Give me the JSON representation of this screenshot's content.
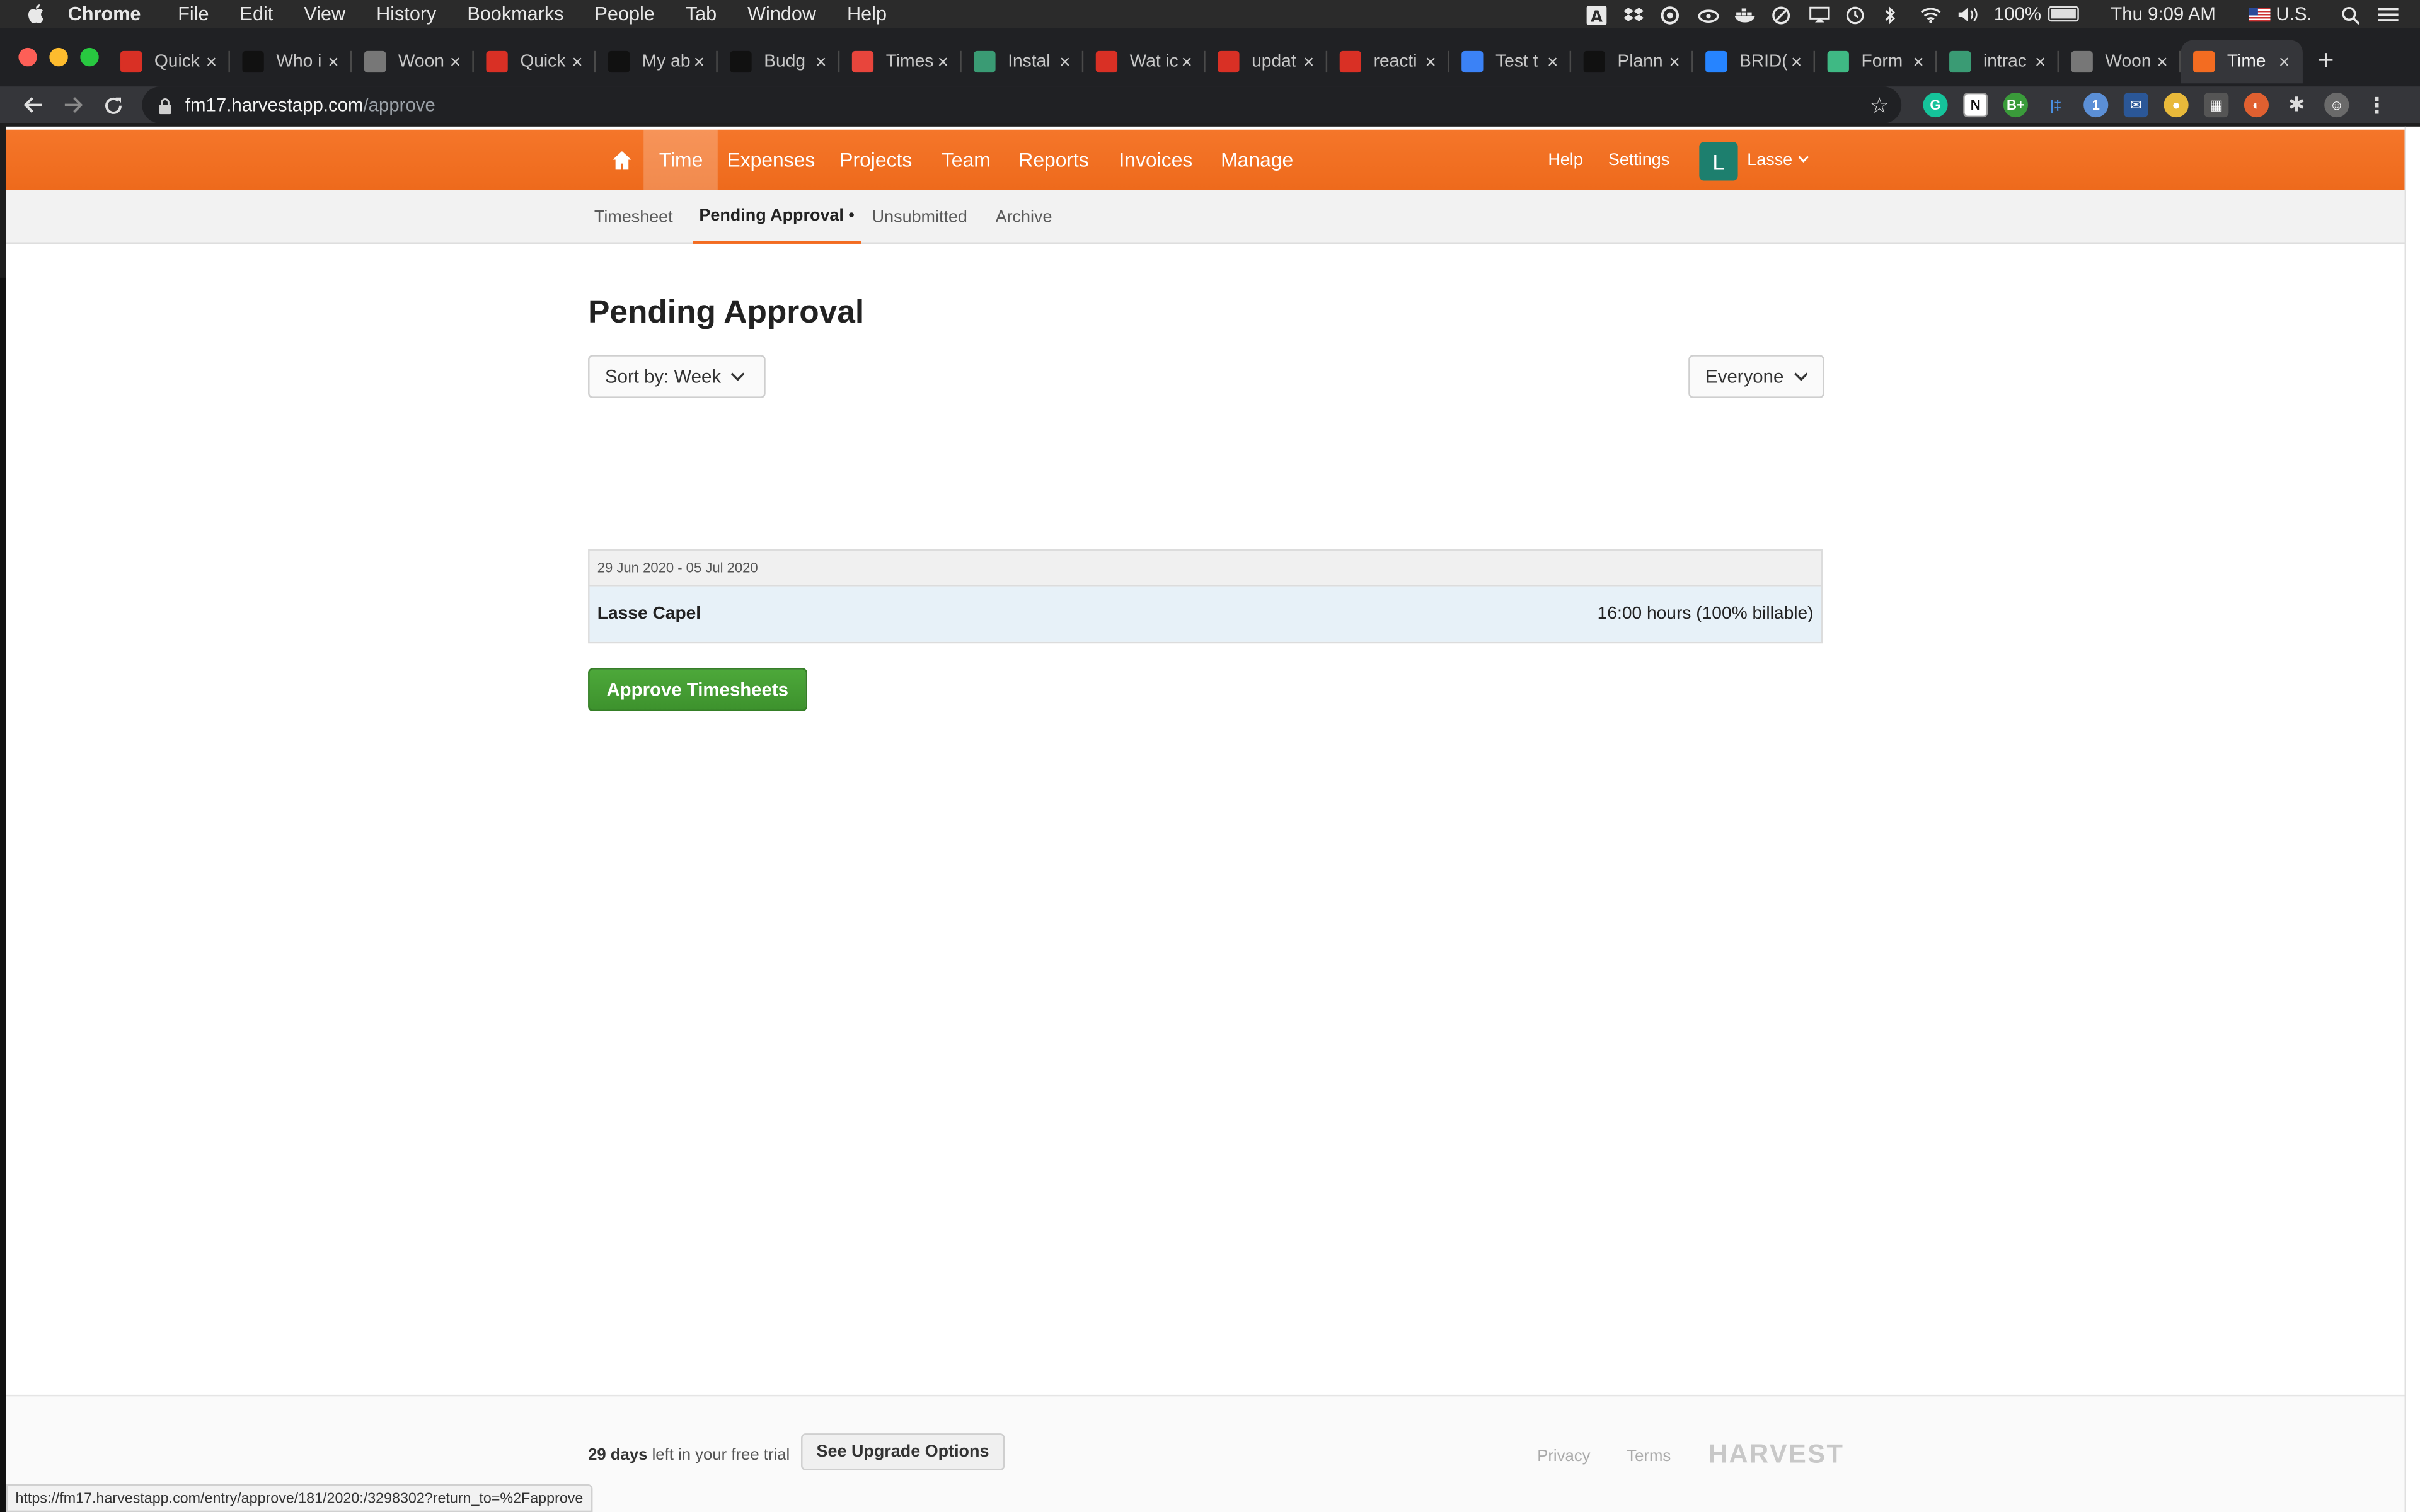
{
  "mac_menu": {
    "app_name": "Chrome",
    "items": [
      "File",
      "Edit",
      "View",
      "History",
      "Bookmarks",
      "People",
      "Tab",
      "Window",
      "Help"
    ],
    "battery": "100%",
    "clock": "Thu 9:09 AM",
    "input_source": "U.S."
  },
  "browser": {
    "tabs": [
      {
        "title": "Quick",
        "icon": "app-grid-icon",
        "color": "#d93025"
      },
      {
        "title": "Who i",
        "icon": "mustache-icon",
        "color": "#111111"
      },
      {
        "title": "Woon",
        "icon": "globe-icon",
        "color": "#777777"
      },
      {
        "title": "Quick",
        "icon": "app-grid-icon",
        "color": "#d93025"
      },
      {
        "title": "My ab",
        "icon": "mustache-icon",
        "color": "#111111"
      },
      {
        "title": "Budg",
        "icon": "mustache-icon",
        "color": "#111111"
      },
      {
        "title": "Times",
        "icon": "harvest-clock-icon",
        "color": "#e8453c"
      },
      {
        "title": "Instal",
        "icon": "triangle-icon",
        "color": "#3a9b74"
      },
      {
        "title": "Wat ic",
        "icon": "gmail-icon",
        "color": "#d93025"
      },
      {
        "title": "updat",
        "icon": "gmail-icon",
        "color": "#d93025"
      },
      {
        "title": "reacti",
        "icon": "gmail-icon",
        "color": "#d93025"
      },
      {
        "title": "Test t",
        "icon": "f-icon",
        "color": "#3b82f6"
      },
      {
        "title": "Plann",
        "icon": "mustache-icon",
        "color": "#111111"
      },
      {
        "title": "BRID(",
        "icon": "diamond-icon",
        "color": "#2684ff"
      },
      {
        "title": "Form",
        "icon": "v-icon",
        "color": "#3fb984"
      },
      {
        "title": "intrac",
        "icon": "triangle-icon",
        "color": "#3a9b74"
      },
      {
        "title": "Woon",
        "icon": "globe-icon",
        "color": "#777777"
      },
      {
        "title": "Time",
        "icon": "harvest-h-icon",
        "color": "#f36c21",
        "active": true
      }
    ],
    "url_host": "fm17.harvestapp.com",
    "url_path": "/approve",
    "status_url": "https://fm17.harvestapp.com/entry/approve/181/2020:/3298302?return_to=%2Fapprove"
  },
  "harvest_nav": {
    "items": [
      "Time",
      "Expenses",
      "Projects",
      "Team",
      "Reports",
      "Invoices",
      "Manage"
    ],
    "active": "Time",
    "help": "Help",
    "settings": "Settings",
    "avatar_letter": "L",
    "user_name": "Lasse",
    "brand_color": "#f36c21"
  },
  "subnav": {
    "items": [
      "Timesheet",
      "Pending Approval •",
      "Unsubmitted",
      "Archive"
    ],
    "active": "Pending Approval •"
  },
  "main": {
    "title": "Pending Approval",
    "sort_label": "Sort by: Week",
    "filter_label": "Everyone",
    "week_range": "29 Jun 2020 - 05 Jul 2020",
    "rows": [
      {
        "person": "Lasse Capel",
        "hours": "16:00 hours (100% billable)"
      }
    ],
    "approve_button": "Approve Timesheets",
    "approve_color": "#45a034"
  },
  "footer": {
    "trial_days": "29 days",
    "trial_text": " left in your free trial",
    "upgrade_button": "See Upgrade Options",
    "privacy": "Privacy",
    "terms": "Terms",
    "logo": "HARVEST"
  }
}
